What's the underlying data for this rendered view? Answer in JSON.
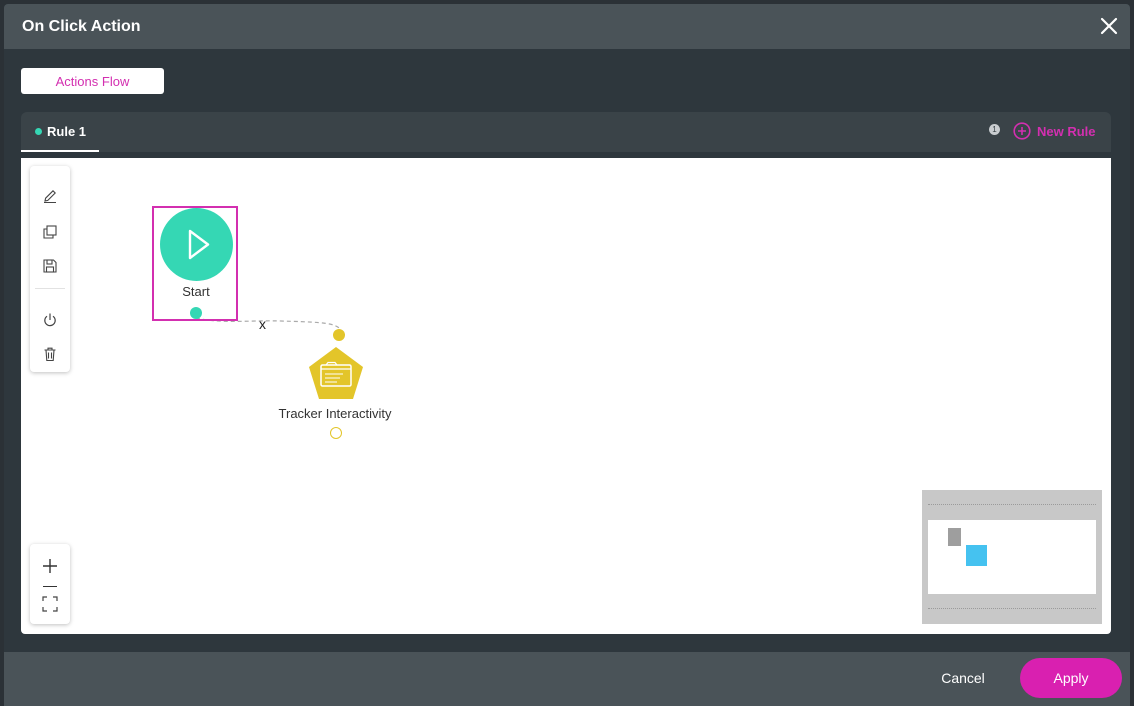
{
  "modal": {
    "title": "On Click Action"
  },
  "tabs": {
    "active_label": "Actions Flow"
  },
  "rules": {
    "items": [
      {
        "label": "Rule 1"
      }
    ],
    "count": "1",
    "new_rule_label": "New Rule"
  },
  "canvas": {
    "nodes": {
      "start_label": "Start",
      "tracker_label": "Tracker Interactivity"
    },
    "connector_delete_label": "x"
  },
  "footer": {
    "cancel_label": "Cancel",
    "apply_label": "Apply"
  },
  "colors": {
    "accent": "#d920b0",
    "start_node": "#35d7b4",
    "action_node": "#e3c52a",
    "minimap_node": "#45c2f0"
  },
  "icons": {
    "toolbar": [
      "pencil-icon",
      "copy-icon",
      "save-icon",
      "power-icon",
      "trash-icon"
    ],
    "zoom": [
      "plus-icon",
      "minus-icon",
      "fit-screen-icon"
    ]
  }
}
